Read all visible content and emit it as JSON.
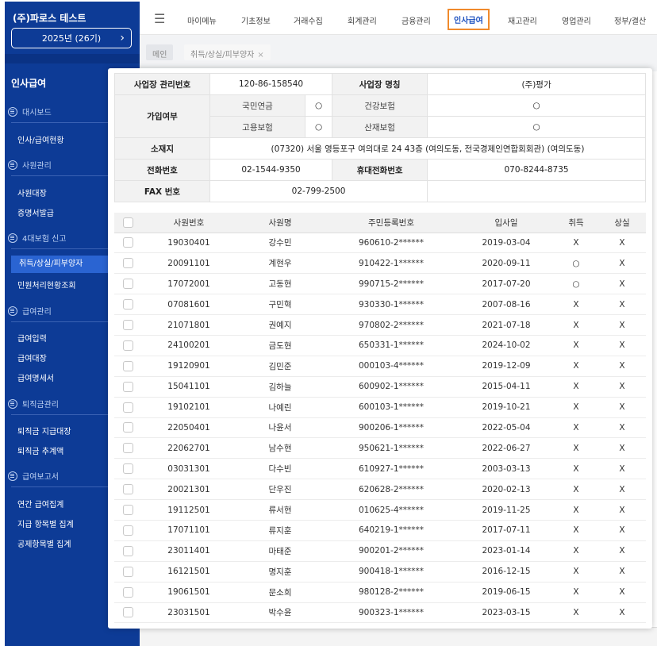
{
  "sidebar": {
    "company": "(주)파로스 테스트",
    "year": "2025년 (26기)",
    "title": "인사급여",
    "groups": [
      {
        "label": "대시보드",
        "items": [
          "인사/급여현황"
        ]
      },
      {
        "label": "사원관리",
        "items": [
          "사원대장",
          "증명서발급"
        ]
      },
      {
        "label": "4대보험 신고",
        "items": [
          "취득/상실/피부양자",
          "민원처리현황조회"
        ]
      },
      {
        "label": "급여관리",
        "items": [
          "급여입력",
          "급여대장",
          "급여명세서"
        ]
      },
      {
        "label": "퇴직금관리",
        "items": [
          "퇴직금 지급대장",
          "퇴직금 추계액"
        ]
      },
      {
        "label": "급여보고서",
        "items": [
          "연간 급여집계",
          "지급 항목별 집계",
          "공제항목별 집계"
        ]
      }
    ]
  },
  "topnav": {
    "items": [
      "마이메뉴",
      "기초정보",
      "거래수집",
      "회계관리",
      "금융관리",
      "인사급여",
      "재고관리",
      "영업관리",
      "정부/결산"
    ],
    "active": "인사급여"
  },
  "tabs": {
    "main": "메인",
    "current": "취득/상실/피부양자",
    "close": "×"
  },
  "info": {
    "biz_no_label": "사업장 관리번호",
    "biz_no": "120-86-158540",
    "biz_name_label": "사업장 명칭",
    "biz_name": "(주)평가",
    "join_label": "가입여부",
    "pension_label": "국민연금",
    "pension": "○",
    "health_label": "건강보험",
    "health": "○",
    "employ_label": "고용보험",
    "employ": "○",
    "accident_label": "산재보험",
    "accident": "○",
    "addr_label": "소재지",
    "addr": "(07320) 서울 영등포구 여의대로 24 43층 (여의도동, 전국경제인연합회회관) (여의도동)",
    "phone_label": "전화번호",
    "phone": "02-1544-9350",
    "mobile_label": "휴대전화번호",
    "mobile": "070-8244-8735",
    "fax_label": "FAX 번호",
    "fax": "02-799-2500"
  },
  "table": {
    "headers": [
      "사원번호",
      "사원명",
      "주민등록번호",
      "입사일",
      "취득",
      "상실"
    ],
    "rows": [
      [
        "19030401",
        "강수민",
        "960610-2******",
        "2019-03-04",
        "X",
        "X"
      ],
      [
        "20091101",
        "계현우",
        "910422-1******",
        "2020-09-11",
        "○",
        "X"
      ],
      [
        "17072001",
        "고동현",
        "990715-2******",
        "2017-07-20",
        "○",
        "X"
      ],
      [
        "07081601",
        "구민혁",
        "930330-1******",
        "2007-08-16",
        "X",
        "X"
      ],
      [
        "21071801",
        "권예지",
        "970802-2******",
        "2021-07-18",
        "X",
        "X"
      ],
      [
        "24100201",
        "금도현",
        "650331-1******",
        "2024-10-02",
        "X",
        "X"
      ],
      [
        "19120901",
        "김민준",
        "000103-4******",
        "2019-12-09",
        "X",
        "X"
      ],
      [
        "15041101",
        "김하늘",
        "600902-1******",
        "2015-04-11",
        "X",
        "X"
      ],
      [
        "19102101",
        "나예린",
        "600103-1******",
        "2019-10-21",
        "X",
        "X"
      ],
      [
        "22050401",
        "나윤서",
        "900206-1******",
        "2022-05-04",
        "X",
        "X"
      ],
      [
        "22062701",
        "남수현",
        "950621-1******",
        "2022-06-27",
        "X",
        "X"
      ],
      [
        "03031301",
        "다수빈",
        "610927-1******",
        "2003-03-13",
        "X",
        "X"
      ],
      [
        "20021301",
        "단우진",
        "620628-2******",
        "2020-02-13",
        "X",
        "X"
      ],
      [
        "19112501",
        "류서현",
        "010625-4******",
        "2019-11-25",
        "X",
        "X"
      ],
      [
        "17071101",
        "류지훈",
        "640219-1******",
        "2017-07-11",
        "X",
        "X"
      ],
      [
        "23011401",
        "마태준",
        "900201-2******",
        "2023-01-14",
        "X",
        "X"
      ],
      [
        "16121501",
        "명지훈",
        "900418-1******",
        "2016-12-15",
        "X",
        "X"
      ],
      [
        "19061501",
        "문소희",
        "980128-2******",
        "2019-06-15",
        "X",
        "X"
      ],
      [
        "23031501",
        "박수윤",
        "900323-1******",
        "2023-03-15",
        "X",
        "X"
      ]
    ]
  }
}
